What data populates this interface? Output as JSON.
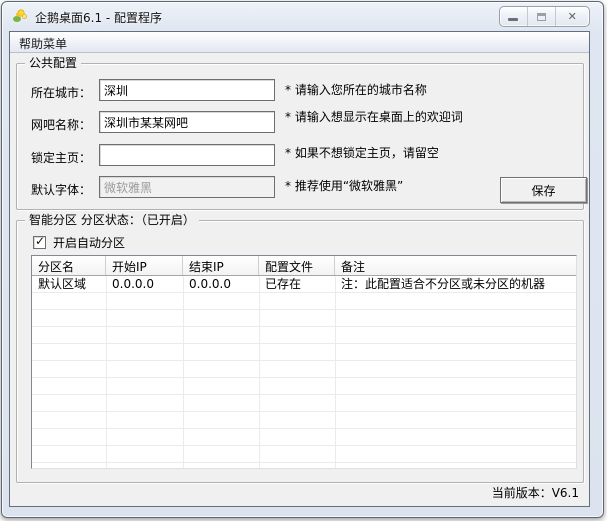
{
  "window": {
    "title": "企鹅桌面6.1 - 配置程序",
    "version_label": "当前版本：V6.1"
  },
  "menu": {
    "help_label": "帮助菜单"
  },
  "public_config": {
    "legend": "公共配置",
    "save_label": "保存",
    "fields": [
      {
        "label": "所在城市：",
        "value": "深圳",
        "hint": "* 请输入您所在的城市名称"
      },
      {
        "label": "网吧名称：",
        "value": "深圳市某某网吧",
        "hint": "* 请输入想显示在桌面上的欢迎词"
      },
      {
        "label": "锁定主页：",
        "value": "",
        "hint": "* 如果不想锁定主页，请留空"
      },
      {
        "label": "默认字体：",
        "value": "微软雅黑",
        "hint": "* 推荐使用“微软雅黑”",
        "disabled": true
      }
    ]
  },
  "partition": {
    "legend": "智能分区 分区状态：（已开启）",
    "auto_partition_label": "开启自动分区",
    "auto_partition_checked": true,
    "table": {
      "headers": [
        "分区名",
        "开始IP",
        "结束IP",
        "配置文件",
        "备注"
      ],
      "rows": [
        [
          "默认区域",
          "0.0.0.0",
          "0.0.0.0",
          "已存在",
          "注：此配置适合不分区或未分区的机器"
        ]
      ]
    }
  },
  "colors": {
    "titlebar_glass": "#dfe6f1",
    "client_bg": "#f0f0f0",
    "disabled_text": "#9c9c9c",
    "grid_line": "#ebebeb",
    "border_dark": "#6e6e6e"
  }
}
